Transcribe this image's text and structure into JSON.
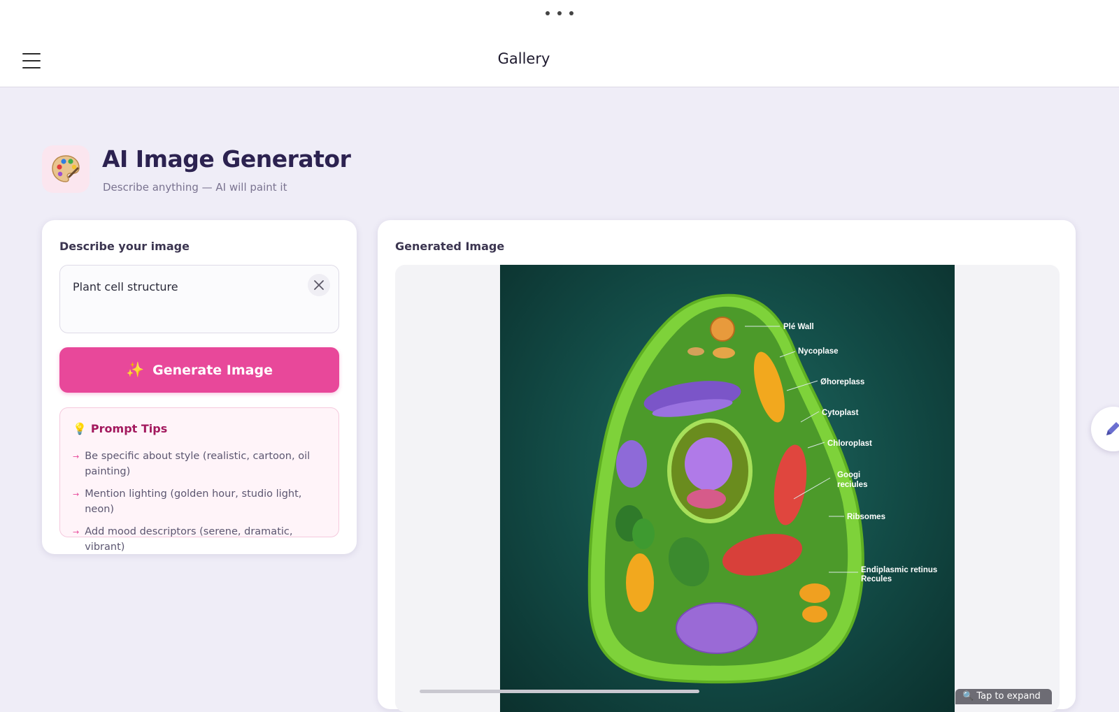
{
  "topbar": {
    "title": "Gallery"
  },
  "header": {
    "icon": "palette-icon",
    "title": "AI Image Generator",
    "subtitle": "Describe anything — AI will paint it"
  },
  "prompt_panel": {
    "label": "Describe your image",
    "input_value": "Plant cell structure",
    "clear_icon": "close-icon",
    "generate_label": "Generate Image",
    "generate_icon": "sparkles-icon",
    "accent_color": "#e8489a"
  },
  "tips": {
    "title": "Prompt Tips",
    "icon": "lightbulb-icon",
    "items": [
      "Be specific about style (realistic, cartoon, oil painting)",
      "Mention lighting (golden hour, studio light, neon)",
      "Add mood descriptors (serene, dramatic, vibrant)"
    ]
  },
  "output_panel": {
    "label": "Generated Image",
    "expand_hint": "🔍 Tap to expand",
    "image_labels": [
      "Plé Wall",
      "Nycoplase",
      "Øhoreplass",
      "Cytoplast",
      "Chloroplast",
      "Googi",
      "reciules",
      "Ribsomes",
      "Endiplasmic retinus",
      "Recules"
    ]
  },
  "fab": {
    "icon": "pencil-icon"
  }
}
